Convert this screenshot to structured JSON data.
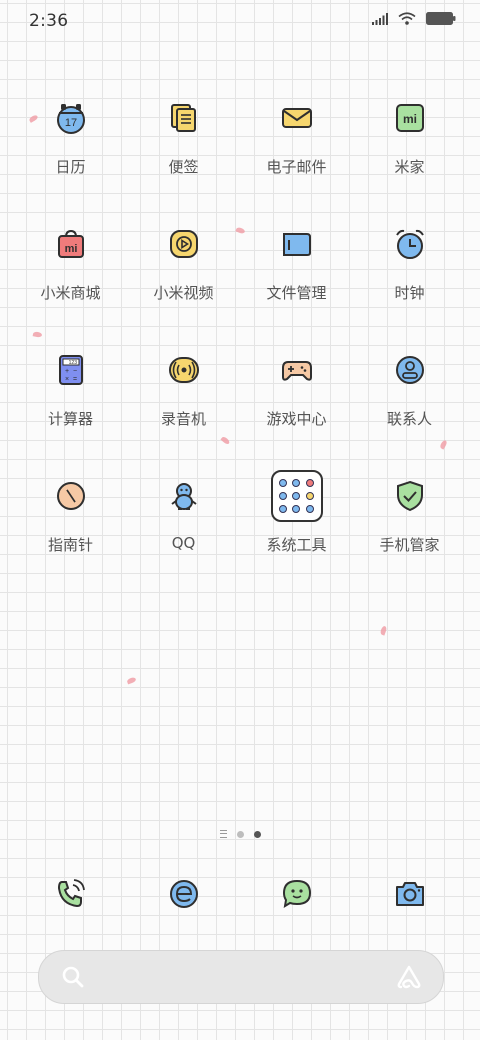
{
  "status_bar": {
    "time": "2:36",
    "icons": [
      "signal-icon",
      "wifi-icon",
      "battery-icon"
    ]
  },
  "apps": [
    {
      "label": "日历",
      "icon": "calendar-icon",
      "badge": "17"
    },
    {
      "label": "便签",
      "icon": "notes-icon"
    },
    {
      "label": "电子邮件",
      "icon": "mail-icon"
    },
    {
      "label": "米家",
      "icon": "mijia-icon",
      "badge": "mi"
    },
    {
      "label": "小米商城",
      "icon": "mi-store-icon",
      "badge": "mi"
    },
    {
      "label": "小米视频",
      "icon": "video-icon"
    },
    {
      "label": "文件管理",
      "icon": "folder-icon"
    },
    {
      "label": "时钟",
      "icon": "alarm-clock-icon"
    },
    {
      "label": "计算器",
      "icon": "calculator-icon",
      "badge": "123"
    },
    {
      "label": "录音机",
      "icon": "recorder-icon"
    },
    {
      "label": "游戏中心",
      "icon": "gamepad-icon"
    },
    {
      "label": "联系人",
      "icon": "contacts-icon"
    },
    {
      "label": "指南针",
      "icon": "compass-icon"
    },
    {
      "label": "QQ",
      "icon": "qq-penguin-icon"
    },
    {
      "label": "系统工具",
      "icon": "system-tools-folder-icon"
    },
    {
      "label": "手机管家",
      "icon": "security-shield-icon"
    }
  ],
  "page_indicator": {
    "pages": 2,
    "current": 2
  },
  "dock": [
    {
      "icon": "phone-icon"
    },
    {
      "icon": "browser-icon"
    },
    {
      "icon": "messages-icon"
    },
    {
      "icon": "camera-icon"
    }
  ],
  "search_bar": {
    "left_icon": "search-icon",
    "right_icon": "assistant-icon"
  },
  "colors": {
    "blue": "#7fb9ee",
    "yellow": "#f6d66e",
    "green": "#a9e0a0",
    "red": "#ef7b7b",
    "peach": "#f6c9a5",
    "outline": "#2f2f2f",
    "petal": "#f0a0a8"
  }
}
